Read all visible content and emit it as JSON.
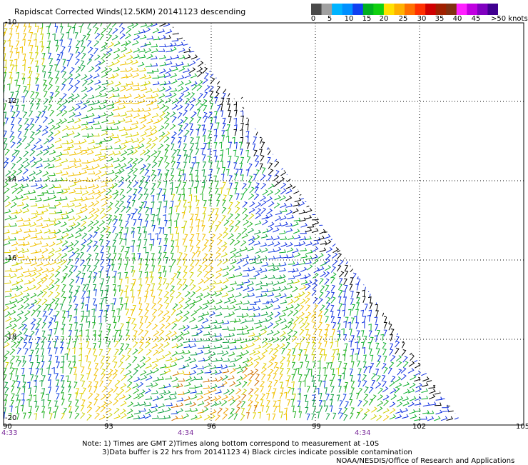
{
  "title": "Rapidscat Corrected Winds(12.5KM) 20141123 descending",
  "colorbar": {
    "labels": [
      "0",
      "5",
      "10",
      "15",
      "20",
      "25",
      "30",
      "35",
      "40",
      "45",
      ">50 knots"
    ],
    "colors": [
      "#4a4a4a",
      "#a0a0a0",
      "#00b4ff",
      "#0090ff",
      "#1040f0",
      "#00b020",
      "#10d010",
      "#ffe000",
      "#ffb000",
      "#ff7000",
      "#ff3000",
      "#d00000",
      "#a02000",
      "#803010",
      "#ff20ff",
      "#c000e0",
      "#8000c0",
      "#400090"
    ]
  },
  "lat_labels": [
    "-10",
    "-12",
    "-14",
    "-16",
    "-18",
    "-20"
  ],
  "lon_labels": [
    "90",
    "93",
    "96",
    "99",
    "102",
    "105"
  ],
  "time_labels": [
    "4:33",
    "4:34",
    "4:34"
  ],
  "notes": {
    "line1": "Note: 1) Times are GMT 2)Times along bottom correspond to measurement at -10S",
    "line2": "3)Data buffer is 22 hrs from 20141123 4) Black circles indicate possible contamination",
    "line3": "NOAA/NESDIS/Office of Research and Applications"
  },
  "map": {
    "lat_range": [
      -20,
      -10
    ],
    "lon_range": [
      90,
      105
    ],
    "wind_speed_range_knots": [
      0,
      50
    ]
  }
}
